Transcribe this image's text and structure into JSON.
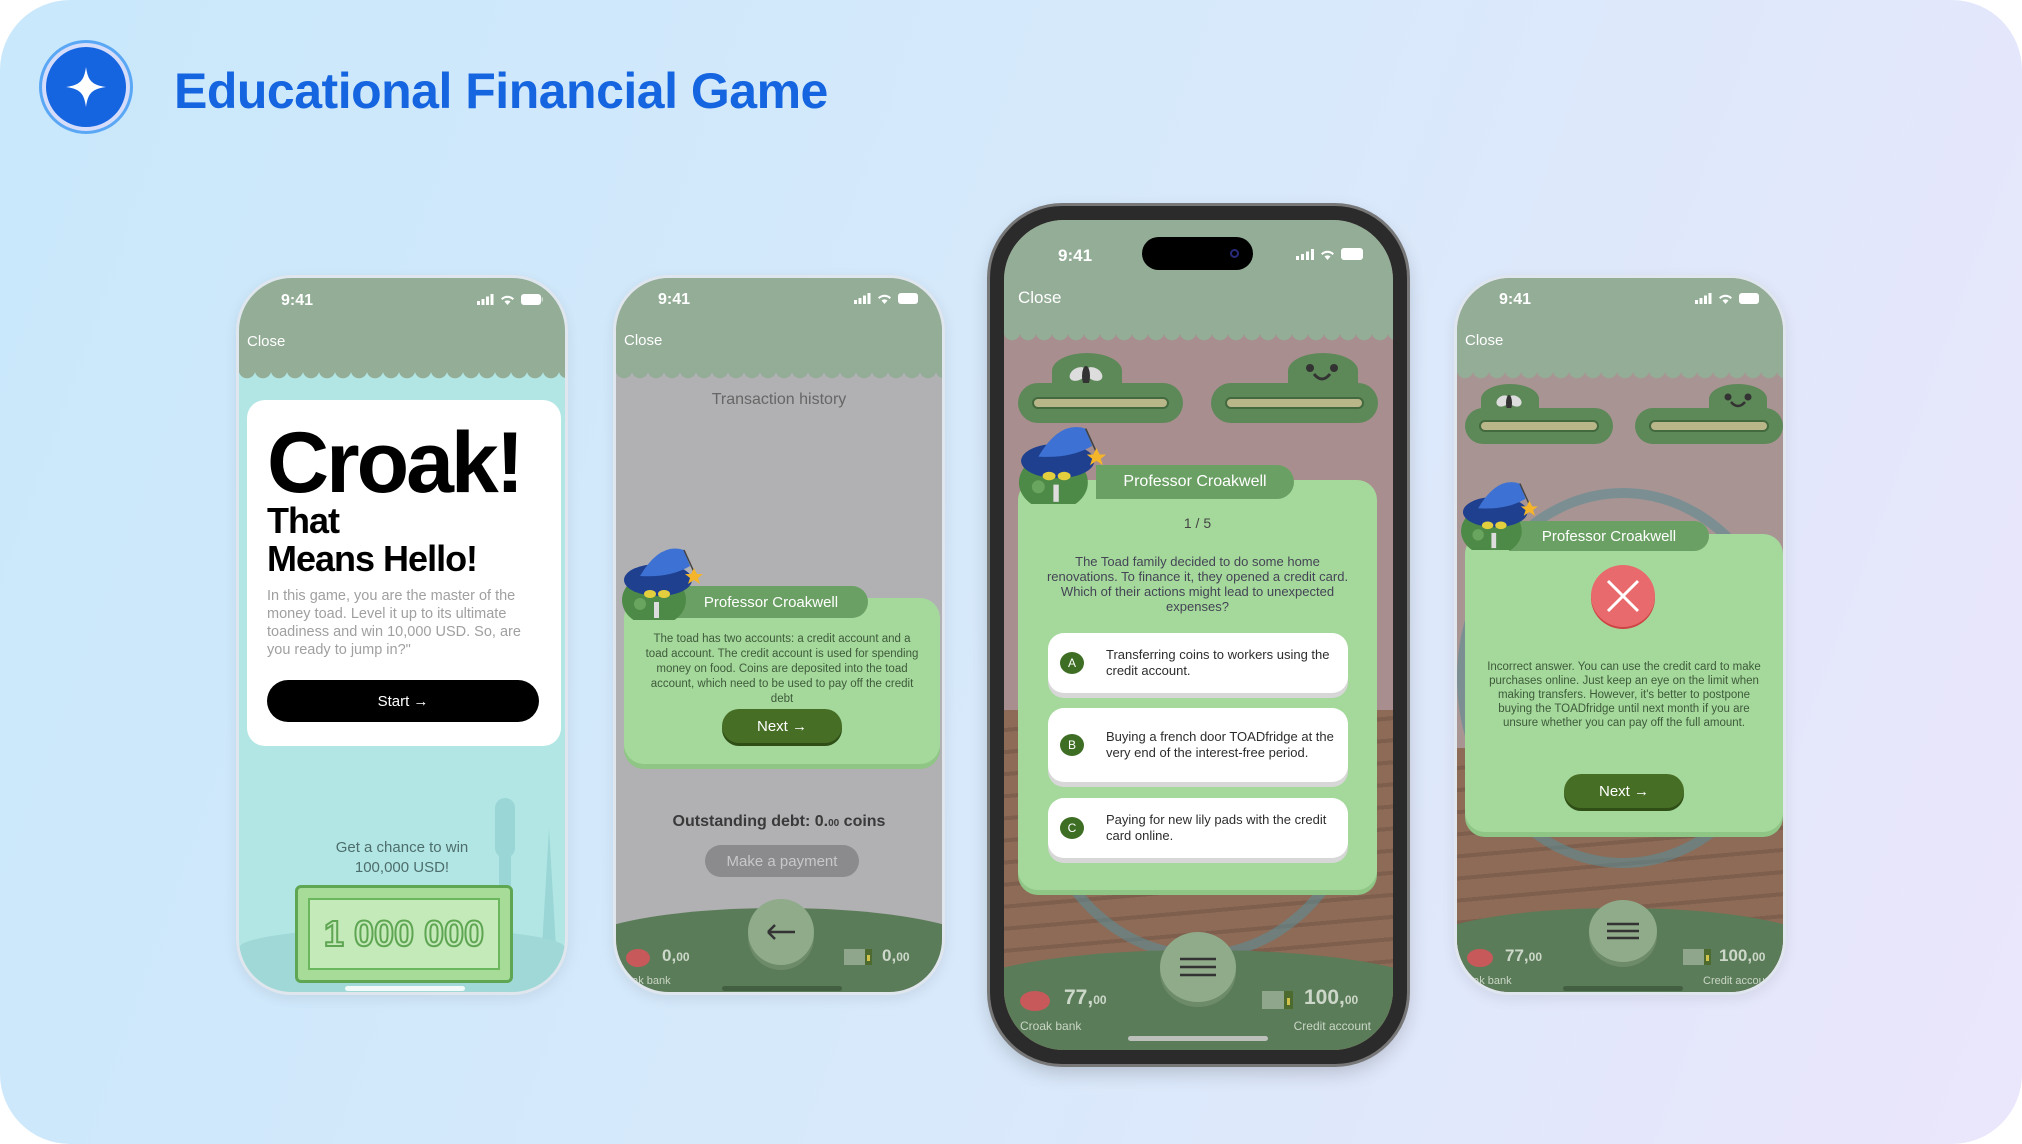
{
  "header": {
    "title": "Educational Financial Game",
    "logo_icon": "sparkle-icon"
  },
  "status": {
    "time": "9:41"
  },
  "common": {
    "close": "Close",
    "professor": "Professor Croakwell",
    "next": "Next →",
    "croak_bank": "Croak bank",
    "credit_account": "Credit account"
  },
  "intro": {
    "headline": "Croak!",
    "line2": "That",
    "line3": "Means Hello!",
    "body": "In this game, you are the master of the money toad. Level it up to its ultimate toadiness and win 10,000 USD. So, are you ready to jump in?\"",
    "start": "Start →",
    "prize_line1": "Get a chance to win",
    "prize_line2": "100,000 USD!",
    "bill": "1 000 000"
  },
  "transactions": {
    "title": "Transaction history",
    "message": "The toad has two accounts: a credit account and a toad account. The credit account is used for spending money on food. Coins are deposited into the toad account, which need to be used to pay off the credit debt",
    "debt_label": "Outstanding debt: 0.",
    "debt_dec": "00",
    "debt_unit": " coins",
    "pay": "Make a payment",
    "bank_int": "0,",
    "bank_dec": "00",
    "credit_int": "0,",
    "credit_dec": "00",
    "bank_label_clipped": "oak bank"
  },
  "quiz": {
    "progress": "1 / 5",
    "question": "The Toad family decided to do some home renovations. To finance it, they opened a credit card. Which of their actions might lead to unexpected expenses?",
    "options": [
      {
        "letter": "A",
        "text": "Transferring coins to workers using the credit account."
      },
      {
        "letter": "B",
        "text": "Buying a french door TOADfridge at the very end of the interest-free period."
      },
      {
        "letter": "C",
        "text": "Paying for new lily pads with the credit card online."
      }
    ],
    "bank_int": "77,",
    "bank_dec": "00",
    "credit_int": "100,",
    "credit_dec": "00"
  },
  "feedback": {
    "result_icon": "close-x-icon",
    "message": "Incorrect answer. You can use the credit card to make purchases online. Just keep an eye on the limit when making transfers. However, it's better to postpone buying the TOADfridge until next month if you are unsure whether you can pay off the full amount.",
    "bank_int": "77,",
    "bank_dec": "00",
    "credit_int": "100,",
    "credit_dec": "00",
    "bank_label_clipped": "oak bank",
    "credit_label_clipped": "Credit account"
  },
  "colors": {
    "brand": "#1565e0",
    "header_green": "#93ad96",
    "card_green": "#a5d99c",
    "button_green": "#476e25",
    "error_red": "#e86a6c"
  }
}
